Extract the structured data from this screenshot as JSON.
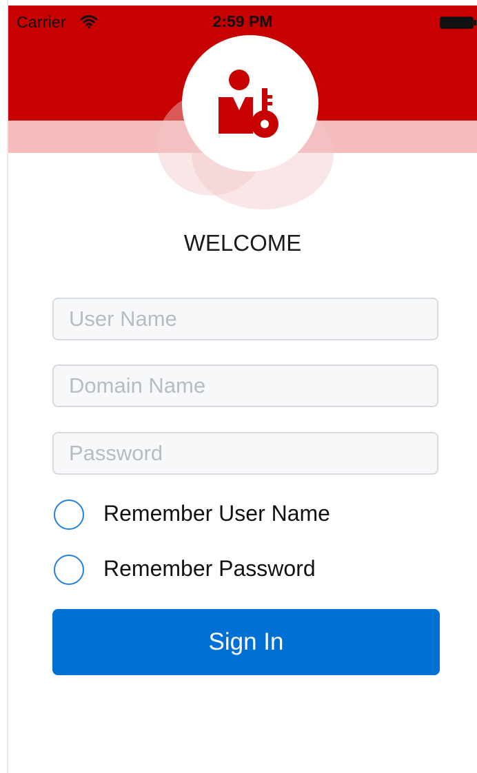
{
  "status_bar": {
    "carrier": "Carrier",
    "time": "2:59 PM",
    "wifi_icon": "wifi-icon",
    "battery_icon": "battery-icon"
  },
  "header": {
    "logo_icon": "user-key-icon",
    "brand_color": "#c70000",
    "band_color": "#f5bcbc"
  },
  "title": "WELCOME",
  "form": {
    "username_placeholder": "User Name",
    "username_value": "",
    "domain_placeholder": "Domain Name",
    "domain_value": "",
    "password_placeholder": "Password",
    "password_value": "",
    "remember_username_label": "Remember User Name",
    "remember_username_checked": false,
    "remember_password_label": "Remember Password",
    "remember_password_checked": false,
    "signin_label": "Sign In",
    "accent_color": "#0071d4"
  }
}
